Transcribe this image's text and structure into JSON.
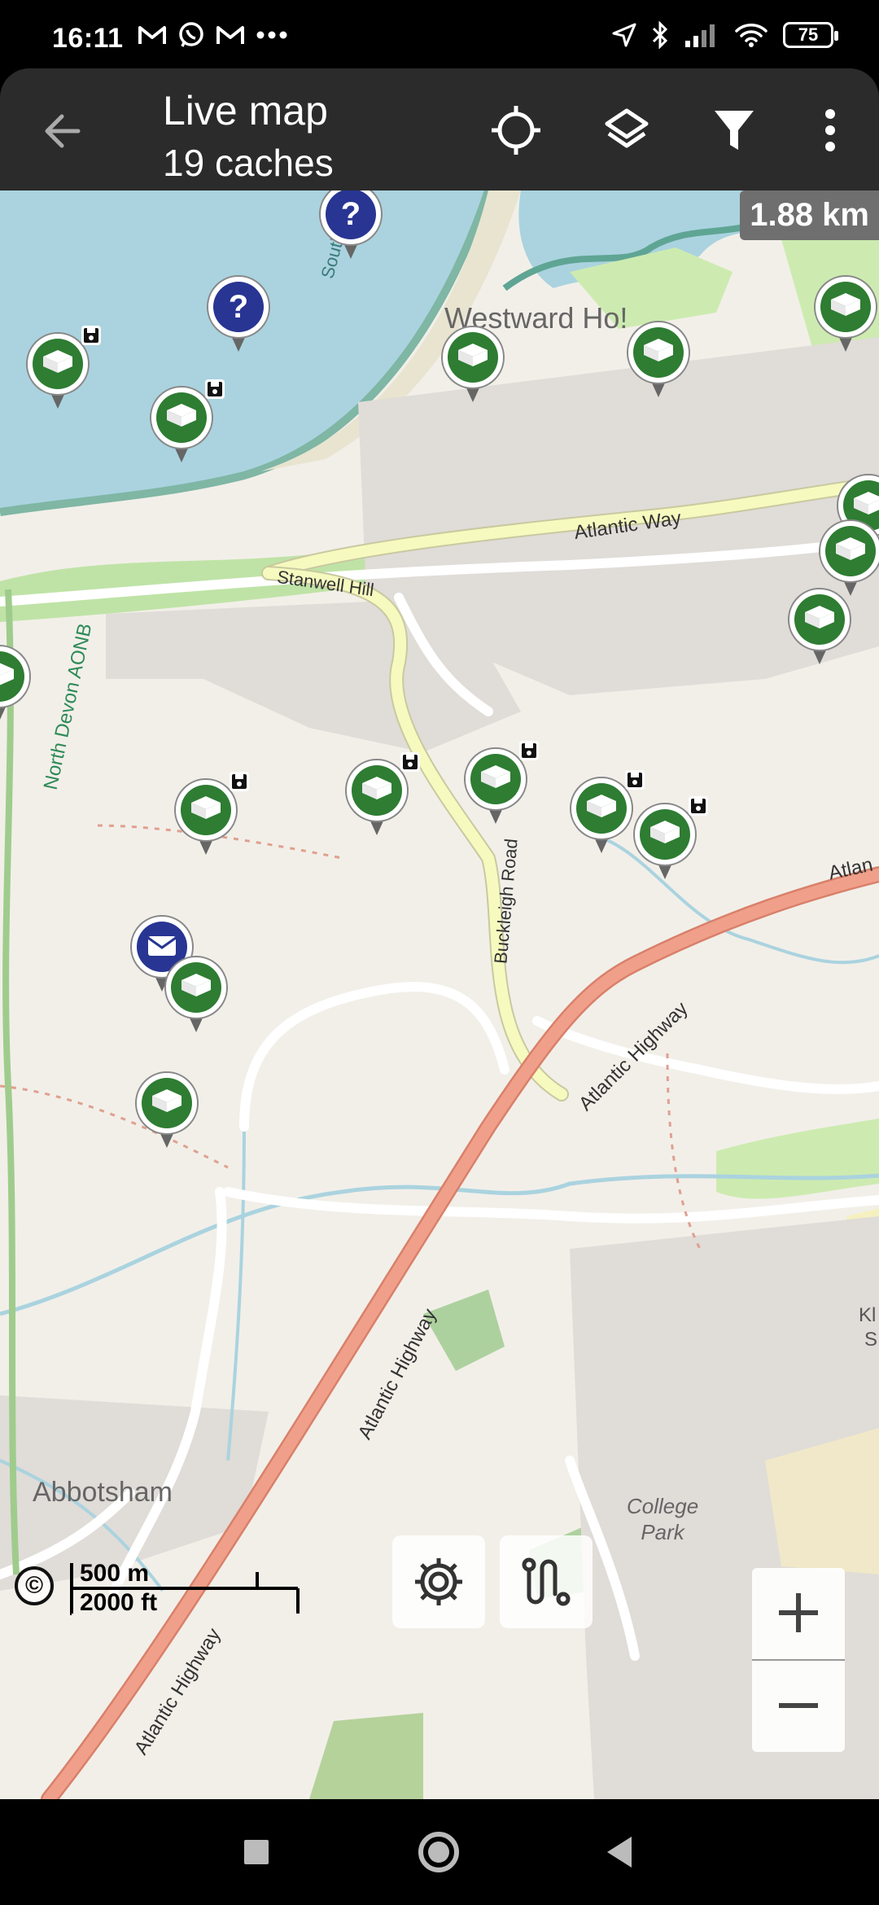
{
  "status_bar": {
    "time": "16:11",
    "notification_icons": [
      "gmail-icon",
      "whatsapp-icon",
      "gmail-icon",
      "more-dots-icon"
    ],
    "battery_level": "75",
    "right_icons": [
      "location-arrow-icon",
      "bluetooth-icon",
      "signal-icon",
      "wifi-icon",
      "battery-icon"
    ]
  },
  "app_bar": {
    "title": "Live map",
    "subtitle": "19 caches",
    "actions": [
      "my-location-icon",
      "layers-icon",
      "filter-icon",
      "overflow-menu-icon"
    ]
  },
  "map": {
    "scale_distance": "1.88 km",
    "scalebar_metric": "500 m",
    "scalebar_imperial": "2000 ft",
    "attribution_symbol": "©",
    "labels": {
      "westward_ho": "Westward Ho!",
      "atlantic_way": "Atlantic Way",
      "stanwell_hill": "Stanwell Hill",
      "north_devon_aonb": "North Devon AONB",
      "buckleigh_road": "Buckleigh Road",
      "atlantic_highway_1": "Atlantic Highway",
      "atlantic_highway_2": "Atlantic Highway",
      "atlantic_highway_3": "Atlantic Highway",
      "atlantic_highway_4": "Atlan",
      "abbotsham": "Abbotsham",
      "college_park": "College\nPark",
      "south_west": "South West",
      "kl": "Kl",
      "s": "S"
    },
    "cache_types": {
      "traditional": "traditional-cache-icon",
      "mystery": "mystery-cache-icon",
      "letterbox": "letterbox-cache-icon"
    },
    "colors": {
      "sea": "#aad3df",
      "land": "#f2efe9",
      "green_area": "#cdebb0",
      "cache_green": "#2e7d32",
      "mystery_blue": "#283593",
      "primary_road": "#f0a08a",
      "secondary_road": "#f7fabf"
    }
  },
  "bottom_controls": {
    "settings_icon": "settings-gear-icon",
    "route_icon": "route-icon",
    "zoom_in": "+",
    "zoom_out": "−"
  },
  "nav_bar": [
    "recents-square-icon",
    "home-circle-icon",
    "back-triangle-icon"
  ]
}
